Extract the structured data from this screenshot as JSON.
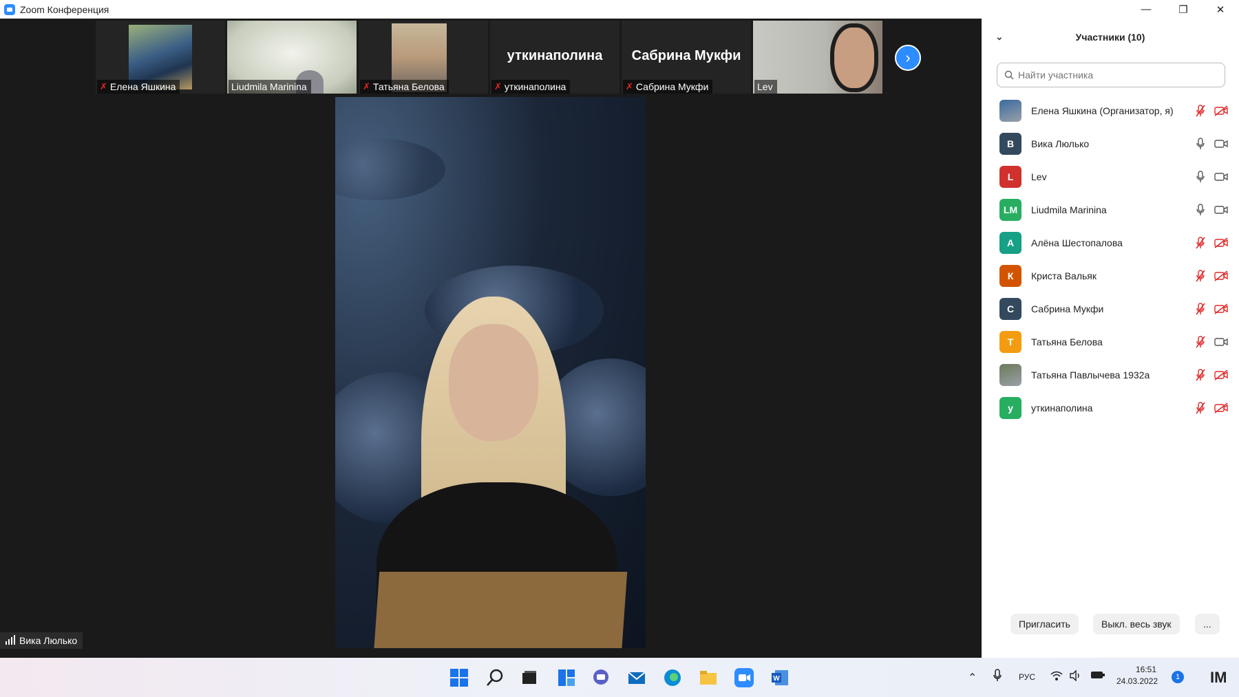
{
  "window": {
    "title": "Zoom Конференция"
  },
  "thumbnails": [
    {
      "name": "Елена Яшкина",
      "muted": true,
      "display": "photo"
    },
    {
      "name": "Liudmila Marinina",
      "muted": false,
      "display": "photo"
    },
    {
      "name": "Татьяна Белова",
      "muted": true,
      "display": "photo"
    },
    {
      "name": "уткинаполина",
      "muted": true,
      "display": "name",
      "big_name": "уткинаполина"
    },
    {
      "name": "Сабрина Мукфи",
      "muted": true,
      "display": "name",
      "big_name": "Сабрина Мукфи"
    },
    {
      "name": "Lev",
      "muted": false,
      "display": "photo"
    }
  ],
  "main_speaker": {
    "name": "Вика Люлько"
  },
  "participants_panel": {
    "title": "Участники (10)",
    "search_placeholder": "Найти участника",
    "participants": [
      {
        "name": "Елена Яшкина (Организатор, я)",
        "initials": "",
        "color": "#3a6aa0",
        "photo": true,
        "mic": "muted",
        "video": "off"
      },
      {
        "name": "Вика Люлько",
        "initials": "В",
        "color": "#34495e",
        "photo": false,
        "mic": "on",
        "video": "on"
      },
      {
        "name": "Lev",
        "initials": "L",
        "color": "#d0312d",
        "photo": false,
        "mic": "on",
        "video": "on"
      },
      {
        "name": "Liudmila Marinina",
        "initials": "LM",
        "color": "#27ae60",
        "photo": false,
        "mic": "on",
        "video": "on"
      },
      {
        "name": "Алёна Шестопалова",
        "initials": "А",
        "color": "#16a085",
        "photo": false,
        "mic": "muted",
        "video": "off"
      },
      {
        "name": "Криста Вальяк",
        "initials": "К",
        "color": "#d35400",
        "photo": false,
        "mic": "muted",
        "video": "off"
      },
      {
        "name": "Сабрина Мукфи",
        "initials": "С",
        "color": "#34495e",
        "photo": false,
        "mic": "muted",
        "video": "off"
      },
      {
        "name": "Татьяна Белова",
        "initials": "Т",
        "color": "#f39c12",
        "photo": false,
        "mic": "muted",
        "video": "on"
      },
      {
        "name": "Татьяна Павлычева 1932a",
        "initials": "",
        "color": "#6d7a5a",
        "photo": true,
        "mic": "muted",
        "video": "off"
      },
      {
        "name": "уткинаполина",
        "initials": "у",
        "color": "#27ae60",
        "photo": false,
        "mic": "muted",
        "video": "off"
      }
    ],
    "invite_label": "Пригласить",
    "mute_all_label": "Выкл. весь звук",
    "more_label": "..."
  },
  "taskbar": {
    "language": "РУС",
    "time": "16:51",
    "date": "24.03.2022",
    "notification_count": "1"
  },
  "colors": {
    "zoom_blue": "#2d8cff",
    "muted_red": "#e02828"
  }
}
